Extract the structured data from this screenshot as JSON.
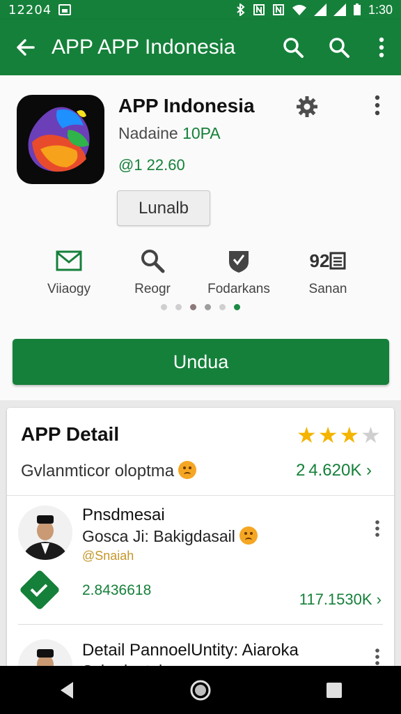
{
  "status_bar": {
    "left_text": "12204",
    "time": "1:30",
    "icons": [
      "image-icon",
      "bluetooth-icon",
      "nfc-icon",
      "silent-icon",
      "wifi-icon",
      "signal-icon",
      "signal-icon"
    ]
  },
  "app_bar": {
    "title": "APP APP Indonesia",
    "back_icon": "arrow-left-icon",
    "actions": [
      "search-icon",
      "search-icon",
      "more-vert-icon"
    ]
  },
  "hero": {
    "app_name": "APP Indonesia",
    "developer_prefix": "Nadaine ",
    "developer_highlight": "10PA",
    "price": "@1 22.60",
    "secondary_button": "Lunalb",
    "stats": [
      {
        "icon": "mail-icon",
        "label": "Viiaogy"
      },
      {
        "icon": "search-icon",
        "label": "Reogr"
      },
      {
        "icon": "shield-hand-icon",
        "label": "Fodarkans"
      },
      {
        "icon": "list-icon",
        "number": "92",
        "label": "Sanan"
      }
    ],
    "page_indicator": {
      "count": 6,
      "active_index": 5
    },
    "install_label": "Undua"
  },
  "detail_card": {
    "title": "APP Detail",
    "rating": 3,
    "rating_max": 4,
    "subtitle": "Gvlanmticor oloptma",
    "count_link": "2 4.620K ›",
    "reviews": [
      {
        "name": "Pnsdmesai",
        "text": "Gosca Ji: Bakigdasail",
        "tag": "@Snaiah"
      },
      {
        "name": "Detail PannoelUntity: Aiaroka",
        "text": "Sshadnutah"
      }
    ],
    "stat_number": "2.8436618",
    "stat_link": "117.1530K ›"
  },
  "nav_bar": [
    "back-triangle-icon",
    "home-circle-icon",
    "recents-square-icon"
  ],
  "colors": {
    "primary": "#15803a",
    "star": "#f4b400",
    "text": "#222222"
  }
}
